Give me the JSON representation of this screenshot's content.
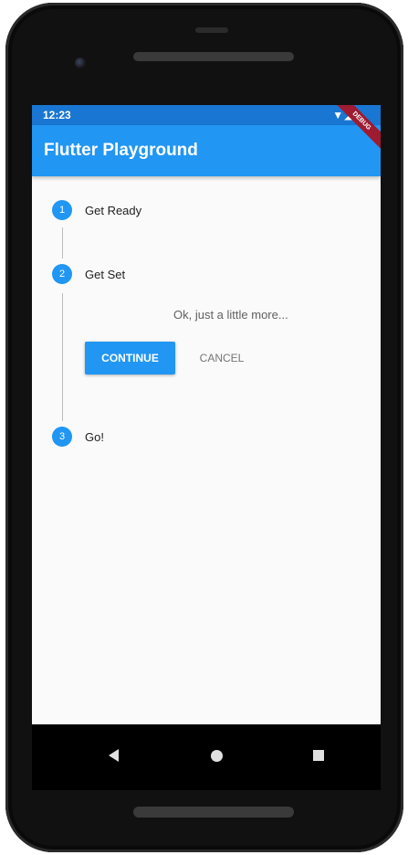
{
  "status_bar": {
    "time": "12:23",
    "icons": "▼◢▮"
  },
  "app_bar": {
    "title": "Flutter Playground",
    "debug_banner": "DEBUG"
  },
  "stepper": {
    "steps": [
      {
        "number": "1",
        "title": "Get Ready",
        "state": "complete"
      },
      {
        "number": "2",
        "title": "Get Set",
        "state": "active",
        "content": "Ok, just a little more..."
      },
      {
        "number": "3",
        "title": "Go!",
        "state": "pending"
      }
    ],
    "continue_label": "CONTINUE",
    "cancel_label": "CANCEL"
  },
  "navigation": {
    "back_icon": "back-triangle-icon",
    "home_icon": "home-circle-icon",
    "recents_icon": "recents-square-icon"
  },
  "colors": {
    "primary": "#2196f3",
    "primary_dark": "#1976d2",
    "background": "#fafafa",
    "debug_banner": "#9e1b32"
  }
}
